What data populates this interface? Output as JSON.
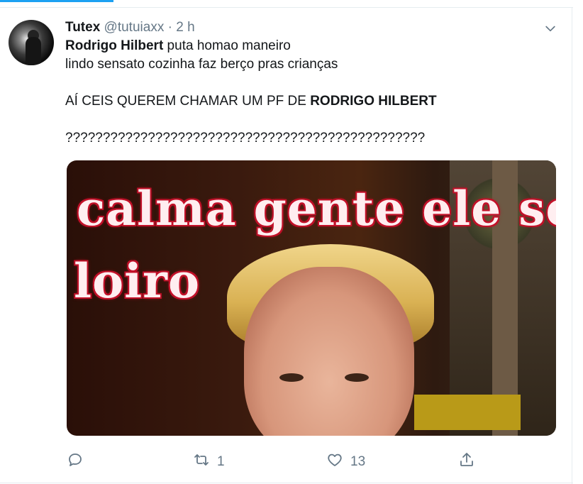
{
  "tweet": {
    "display_name": "Tutex",
    "handle": "@tutuiaxx",
    "separator": "·",
    "time": "2 h",
    "line1_bold": "Rodrigo Hilbert",
    "line1_rest": " puta homao maneiro",
    "line2": "lindo sensato cozinha faz berço pras crianças",
    "line3_pre": "AÍ CEIS QUEREM CHAMAR UM PF DE ",
    "line3_bold": "RODRIGO HILBERT",
    "line4": "????????????????????????????????????????????????",
    "media": {
      "caption_line1": "calma gente ele só é",
      "caption_line2": "loiro"
    },
    "actions": {
      "reply_count": "",
      "retweet_count": "1",
      "like_count": "13"
    }
  },
  "colors": {
    "accent": "#1da1f2",
    "secondary_text": "#657786",
    "meme_red": "#c2122a"
  },
  "icons": [
    "chevron-down-icon",
    "reply-icon",
    "retweet-icon",
    "like-icon",
    "share-icon"
  ]
}
